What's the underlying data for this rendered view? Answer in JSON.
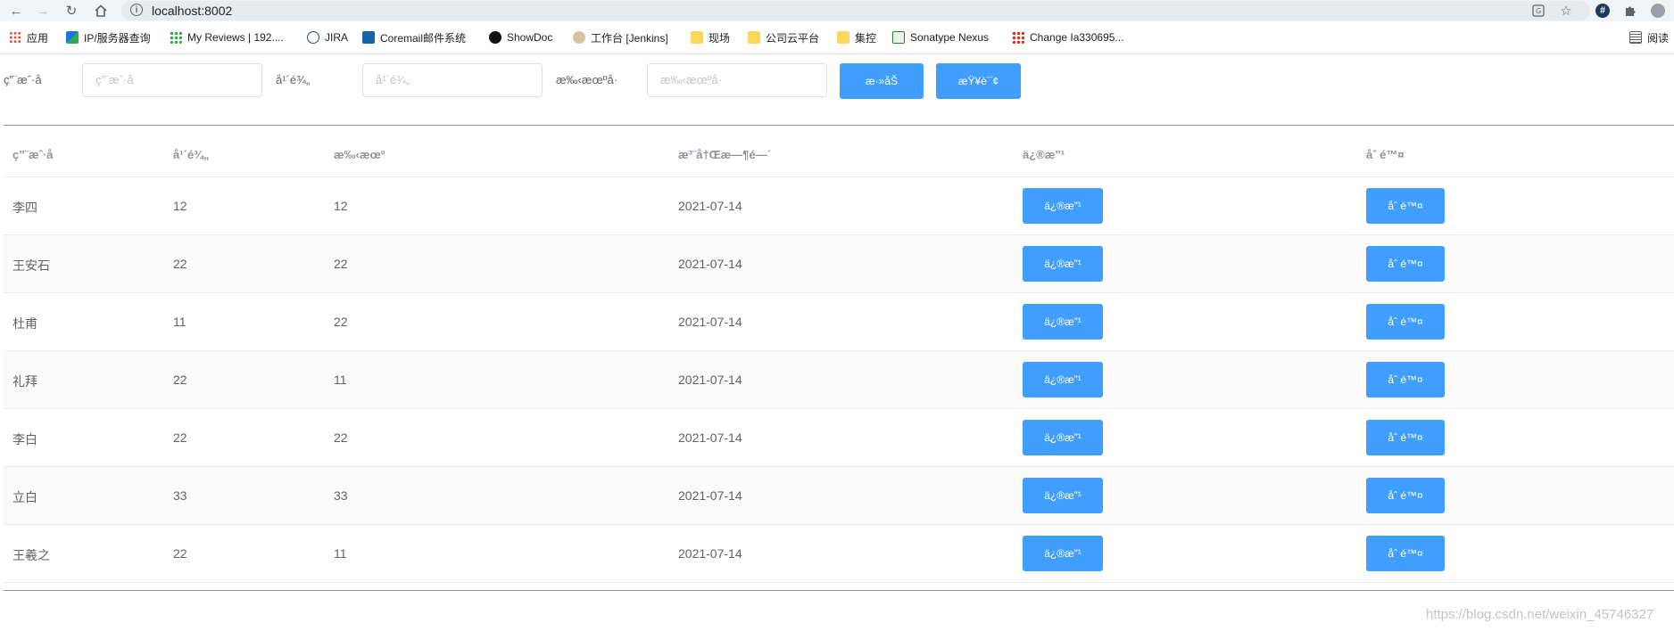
{
  "browser": {
    "url": "localhost:8002"
  },
  "bookmarks": [
    {
      "label": "应用",
      "icon": "apps-grid-icon"
    },
    {
      "label": "IP/服务器查询",
      "icon": "bookmark-favicon"
    },
    {
      "label": "My Reviews | 192....",
      "icon": "bookmark-favicon"
    },
    {
      "label": "JIRA",
      "icon": "jira-icon"
    },
    {
      "label": "Coremail邮件系统",
      "icon": "coremail-icon"
    },
    {
      "label": "ShowDoc",
      "icon": "showdoc-icon"
    },
    {
      "label": "工作台 [Jenkins]",
      "icon": "jenkins-icon"
    },
    {
      "label": "现场",
      "icon": "folder-icon"
    },
    {
      "label": "公司云平台",
      "icon": "folder-icon"
    },
    {
      "label": "集控",
      "icon": "folder-icon"
    },
    {
      "label": "Sonatype Nexus",
      "icon": "nexus-icon"
    },
    {
      "label": "Change Ia330695...",
      "icon": "bookmark-favicon"
    },
    {
      "label": "阅读",
      "icon": "reading-list-icon"
    }
  ],
  "filters": {
    "label_1": "ç”¨æˆ·å",
    "placeholder_1": "ç”¨æˆ·å",
    "label_2": "å¹´é¾„",
    "placeholder_2": "å¹´é¾„",
    "label_3": "æ‰‹æœºå·",
    "placeholder_3": "æ‰‹æœºå·",
    "add_button": "æ·»åŠ",
    "search_button": "æŸ¥è¯¢"
  },
  "table": {
    "headers": [
      "ç”¨æˆ·å",
      "å¹´é¾„",
      "æ‰‹æœº",
      "æ³¨å†Œæ—¶é—´",
      "ä¿®æ”¹",
      "åˆ é™¤"
    ],
    "edit_label": "ä¿®æ”¹",
    "delete_label": "åˆ é™¤",
    "rows": [
      {
        "name": "李四",
        "age": "12",
        "phone": "12",
        "date": "2021-07-14"
      },
      {
        "name": "王安石",
        "age": "22",
        "phone": "22",
        "date": "2021-07-14"
      },
      {
        "name": "杜甫",
        "age": "11",
        "phone": "22",
        "date": "2021-07-14"
      },
      {
        "name": "礼拜",
        "age": "22",
        "phone": "11",
        "date": "2021-07-14"
      },
      {
        "name": "李白",
        "age": "22",
        "phone": "22",
        "date": "2021-07-14"
      },
      {
        "name": "立白",
        "age": "33",
        "phone": "33",
        "date": "2021-07-14"
      },
      {
        "name": "王羲之",
        "age": "22",
        "phone": "11",
        "date": "2021-07-14"
      }
    ]
  },
  "watermark": "https://blog.csdn.net/weixin_45746327",
  "colors": {
    "primary": "#409eff",
    "text": "#606266",
    "header_text": "#909399",
    "stripe": "#fafafa"
  }
}
